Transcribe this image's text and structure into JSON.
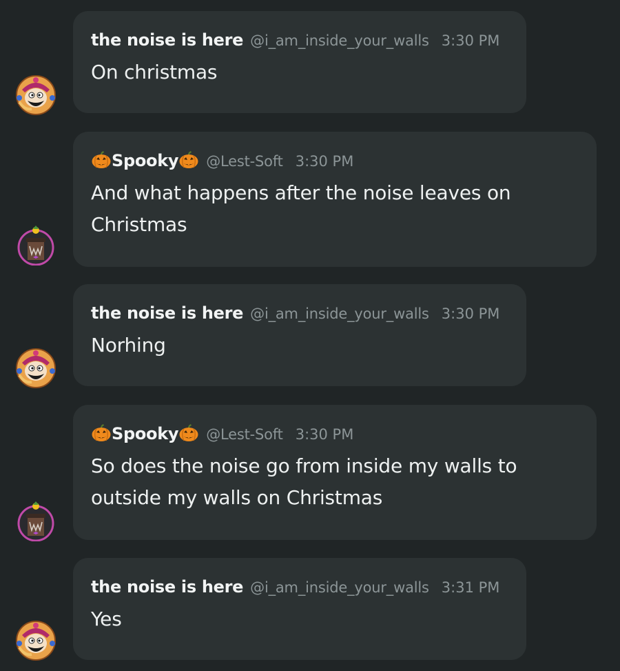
{
  "messages": [
    {
      "author": "the noise is here",
      "handle": "@i_am_inside_your_walls",
      "time": "3:30 PM",
      "text": "On christmas",
      "avatar": "noise-avatar"
    },
    {
      "author": "Spooky",
      "handle": "@Lest-Soft",
      "time": "3:30 PM",
      "text": "And what happens after the noise leaves on Christmas",
      "avatar": "spooky-avatar"
    },
    {
      "author": "the noise is here",
      "handle": "@i_am_inside_your_walls",
      "time": "3:30 PM",
      "text": "Norhing",
      "avatar": "noise-avatar"
    },
    {
      "author": "Spooky",
      "handle": "@Lest-Soft",
      "time": "3:30 PM",
      "text": "So does the noise go from inside my walls to outside my walls on Christmas",
      "avatar": "spooky-avatar"
    },
    {
      "author": "the noise is here",
      "handle": "@i_am_inside_your_walls",
      "time": "3:31 PM",
      "text": "Yes",
      "avatar": "noise-avatar"
    }
  ],
  "colors": {
    "background": "#202526",
    "bubble": "#2c3233",
    "name": "#f2f4f4",
    "meta": "#8c9597",
    "text": "#eef1f1",
    "pumpkin": "#f08a1c"
  }
}
